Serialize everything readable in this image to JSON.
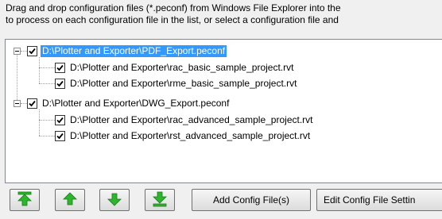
{
  "instructions": {
    "line1": "Drag and drop configuration files (*.peconf) from Windows File Explorer into the",
    "line2": "to process on each configuration file in the list, or select a configuration file and"
  },
  "tree": {
    "items": [
      {
        "label": "D:\\Plotter and Exporter\\PDF_Export.peconf",
        "checked": true,
        "selected": true
      },
      {
        "label": "D:\\Plotter and Exporter\\rac_basic_sample_project.rvt",
        "checked": true
      },
      {
        "label": "D:\\Plotter and Exporter\\rme_basic_sample_project.rvt",
        "checked": true
      },
      {
        "label": "D:\\Plotter and Exporter\\DWG_Export.peconf",
        "checked": true
      },
      {
        "label": "D:\\Plotter and Exporter\\rac_advanced_sample_project.rvt",
        "checked": true
      },
      {
        "label": "D:\\Plotter and Exporter\\rst_advanced_sample_project.rvt",
        "checked": true
      }
    ]
  },
  "buttons": {
    "move_top_icon": "move-to-top-icon",
    "move_up_icon": "move-up-icon",
    "move_down_icon": "move-down-icon",
    "move_bottom_icon": "move-to-bottom-icon",
    "add_config": "Add Config File(s)",
    "edit_config": "Edit  Config  File Settin"
  },
  "colors": {
    "selection": "#3399ff",
    "arrow_green": "#2db52d"
  }
}
